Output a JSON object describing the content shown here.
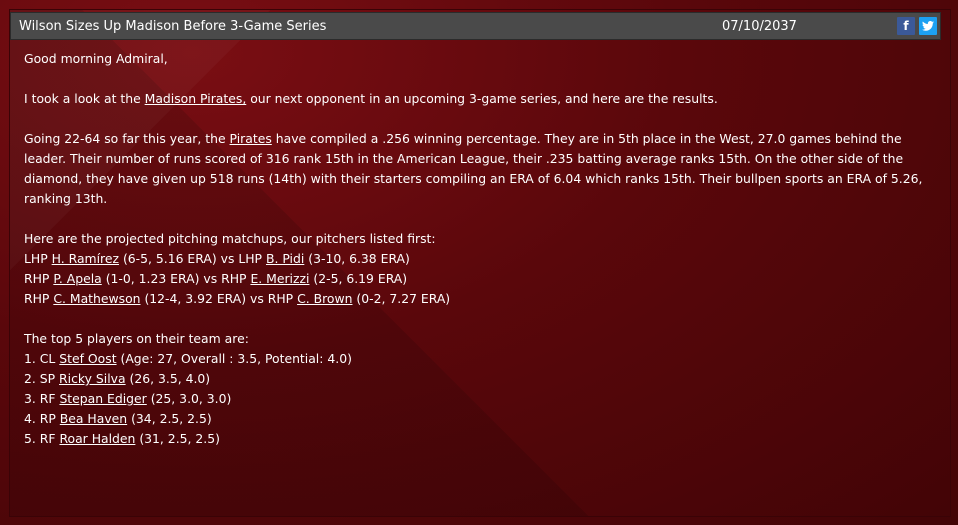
{
  "header": {
    "title": "Wilson Sizes Up Madison Before 3-Game Series",
    "date": "07/10/2037",
    "facebook_label": "f",
    "twitter_label": "t"
  },
  "greeting": "Good morning Admiral,",
  "intro": {
    "pre": "I took a look at the ",
    "team_link": "Madison Pirates,",
    "post": " our next opponent in an upcoming 3-game series, and here are the results."
  },
  "summary": {
    "pre": "Going 22-64 so far this year, the ",
    "team_link": "Pirates",
    "post": " have compiled a .256 winning percentage. They are in 5th place in the West, 27.0 games behind the leader. Their number of runs scored of 316 rank 15th in the American League, their .235 batting average ranks 15th. On the other side of the diamond, they have given up 518 runs (14th) with their starters compiling an ERA of 6.04 which ranks 15th. Their bullpen sports an ERA of 5.26, ranking 13th."
  },
  "matchups": {
    "heading": "Here are the projected pitching matchups, our pitchers listed first:",
    "rows": [
      {
        "hand1": "LHP ",
        "p1": "H. Ramírez",
        "s1": " (6-5, 5.16 ERA) vs LHP ",
        "p2": "B. Pidi",
        "s2": " (3-10, 6.38 ERA)"
      },
      {
        "hand1": "RHP ",
        "p1": "P. Apela",
        "s1": " (1-0, 1.23 ERA) vs RHP ",
        "p2": "E. Merizzi",
        "s2": " (2-5, 6.19 ERA)"
      },
      {
        "hand1": "RHP ",
        "p1": "C. Mathewson",
        "s1": " (12-4, 3.92 ERA) vs RHP ",
        "p2": "C. Brown",
        "s2": " (0-2, 7.27 ERA)"
      }
    ]
  },
  "top_players": {
    "heading": "The top 5 players on their team are:",
    "rows": [
      {
        "pre": "1. CL ",
        "name": "Stef Oost",
        "post": " (Age: 27, Overall : 3.5, Potential: 4.0)"
      },
      {
        "pre": "2. SP ",
        "name": "Ricky Silva",
        "post": " (26, 3.5, 4.0)"
      },
      {
        "pre": "3. RF ",
        "name": "Stepan Ediger",
        "post": " (25, 3.0, 3.0)"
      },
      {
        "pre": "4. RP ",
        "name": "Bea Haven",
        "post": " (34, 2.5, 2.5)"
      },
      {
        "pre": "5. RF ",
        "name": "Roar Halden",
        "post": " (31, 2.5, 2.5)"
      }
    ]
  }
}
